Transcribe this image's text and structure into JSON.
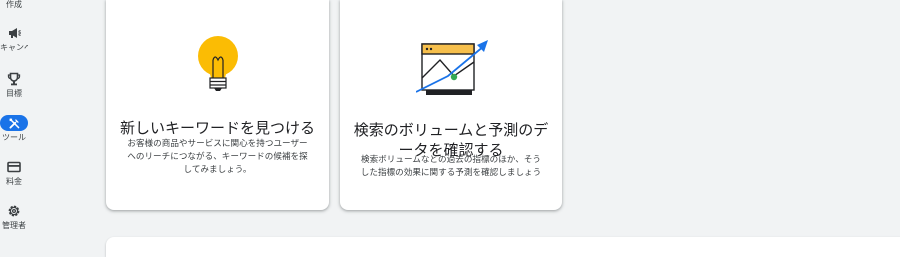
{
  "sidebar": {
    "items": [
      {
        "label": "作成",
        "icon": "create-icon"
      },
      {
        "label": "キャンペーン",
        "icon": "megaphone-icon"
      },
      {
        "label": "目標",
        "icon": "trophy-icon"
      },
      {
        "label": "ツール",
        "icon": "tools-icon",
        "active": true
      },
      {
        "label": "料金",
        "icon": "billing-card-icon"
      },
      {
        "label": "管理者",
        "icon": "gear-icon"
      }
    ]
  },
  "cards": [
    {
      "icon": "lightbulb-icon",
      "title": "新しいキーワードを見つける",
      "description_lines": [
        "お客様の商品やサービスに関心を持つユーザー",
        "へのリーチにつながる、キーワードの候補を探",
        "してみましょう。"
      ]
    },
    {
      "icon": "trend-chart-icon",
      "title_lines": [
        "検索のボリュームと予測のデ",
        "ータを確認する"
      ],
      "description_lines": [
        "検索ボリュームなどの過去の指標のほか、そう",
        "した指標の効果に関する予測を確認しましょう"
      ]
    }
  ],
  "colors": {
    "accent": "#1a73e8",
    "bulb": "#fbbc04",
    "chart_header": "#f6bf4c",
    "chart_point": "#34a853",
    "background": "#f1f3f4"
  }
}
